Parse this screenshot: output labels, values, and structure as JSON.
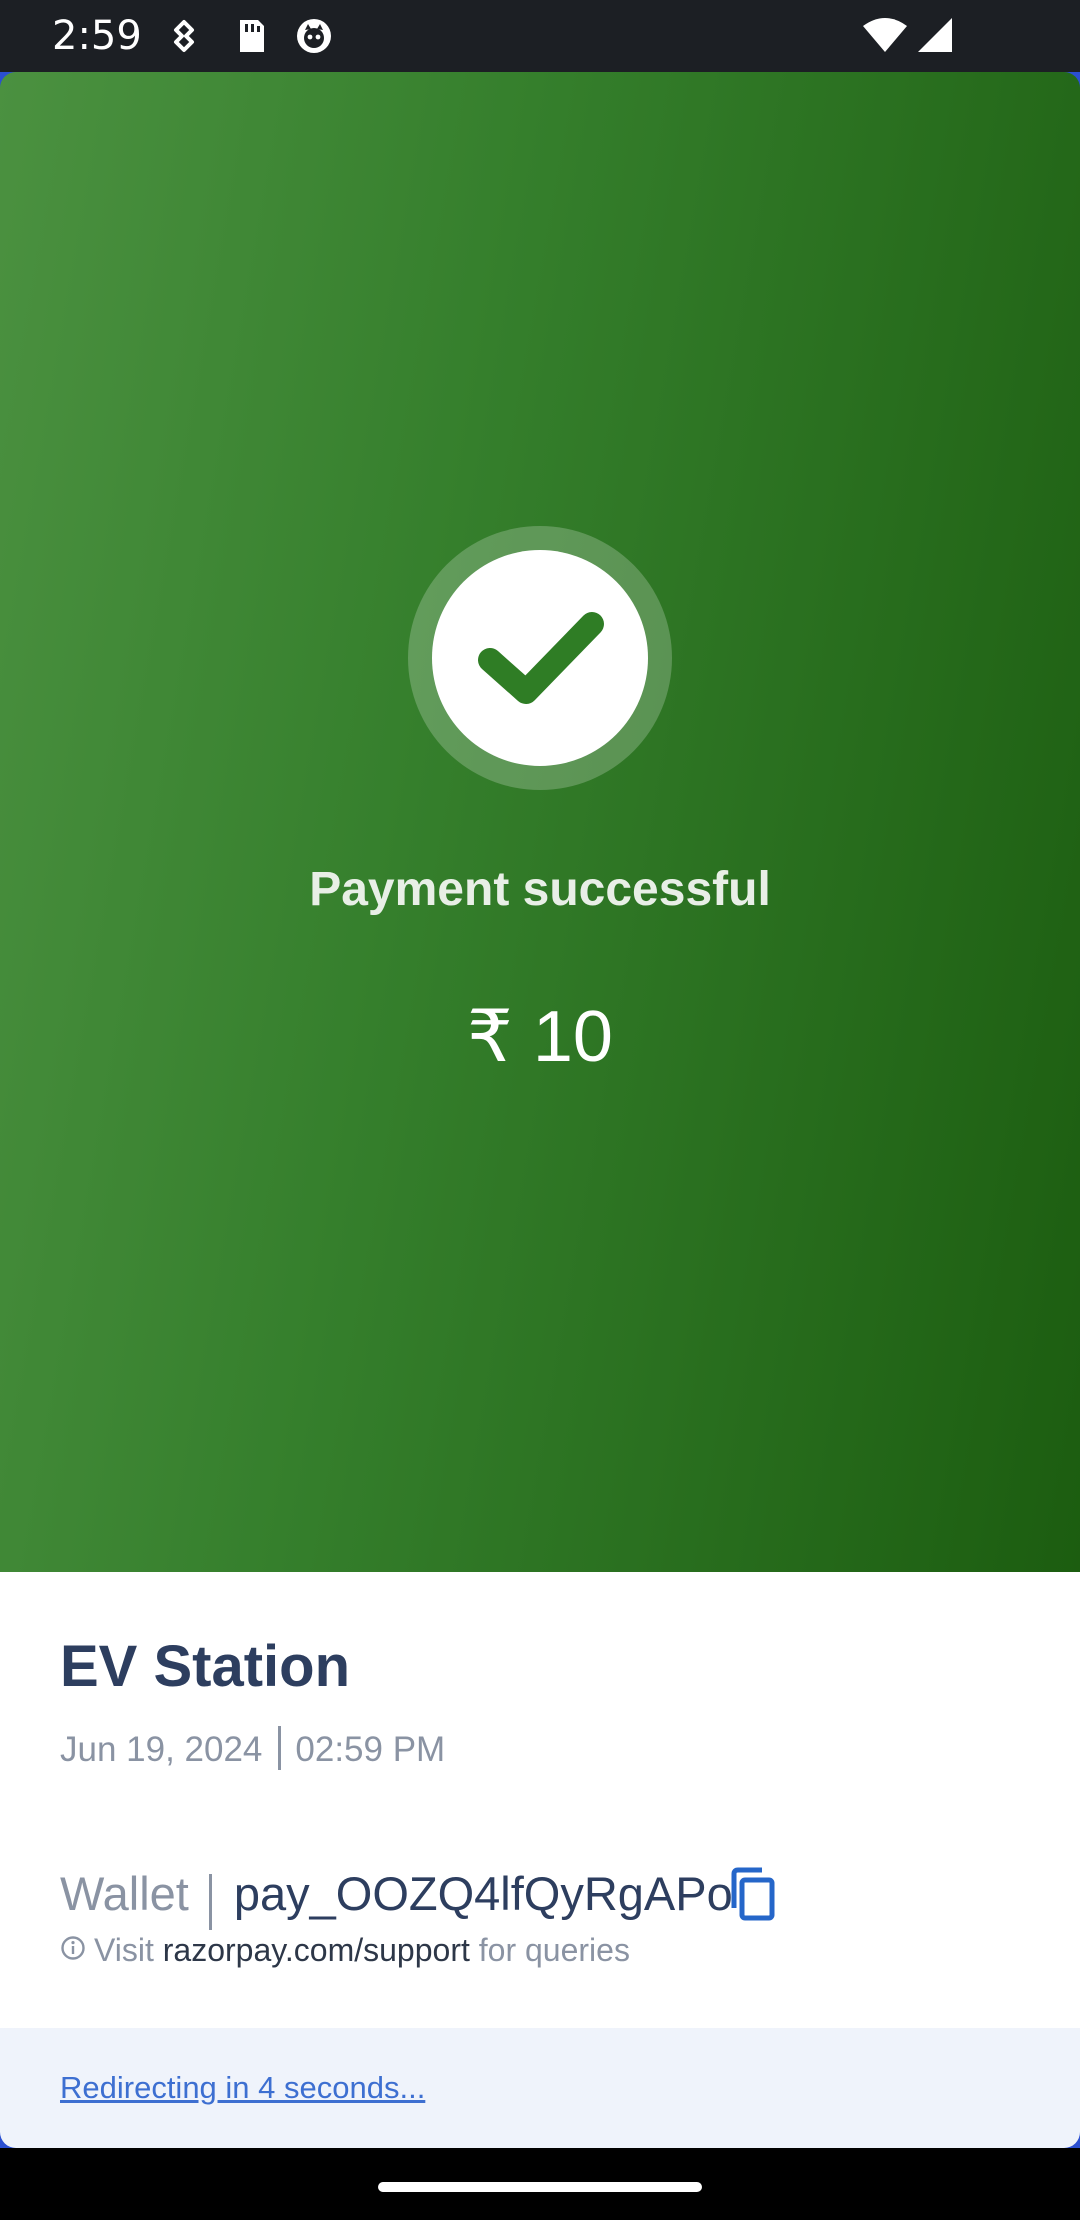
{
  "status_bar": {
    "time": "2:59",
    "icons": [
      "navigation-icon",
      "sd-card-icon",
      "app-notification-icon",
      "wifi-icon",
      "signal-icon"
    ]
  },
  "hero": {
    "title": "Payment successful",
    "amount": "₹ 10",
    "icon": "check-icon",
    "colors": {
      "gradient_start": "#4b9140",
      "gradient_end": "#1c5d10"
    }
  },
  "details": {
    "merchant": "EV Station",
    "date": "Jun 19, 2024",
    "time": "02:59 PM",
    "method": "Wallet",
    "payment_id": "pay_OOZQ4lfQyRgAPo",
    "copy_icon": "copy-icon",
    "support_prefix": "Visit",
    "support_link": "razorpay.com/support",
    "support_suffix": "for queries"
  },
  "footer": {
    "redirect_text": "Redirecting in 4 seconds..."
  }
}
